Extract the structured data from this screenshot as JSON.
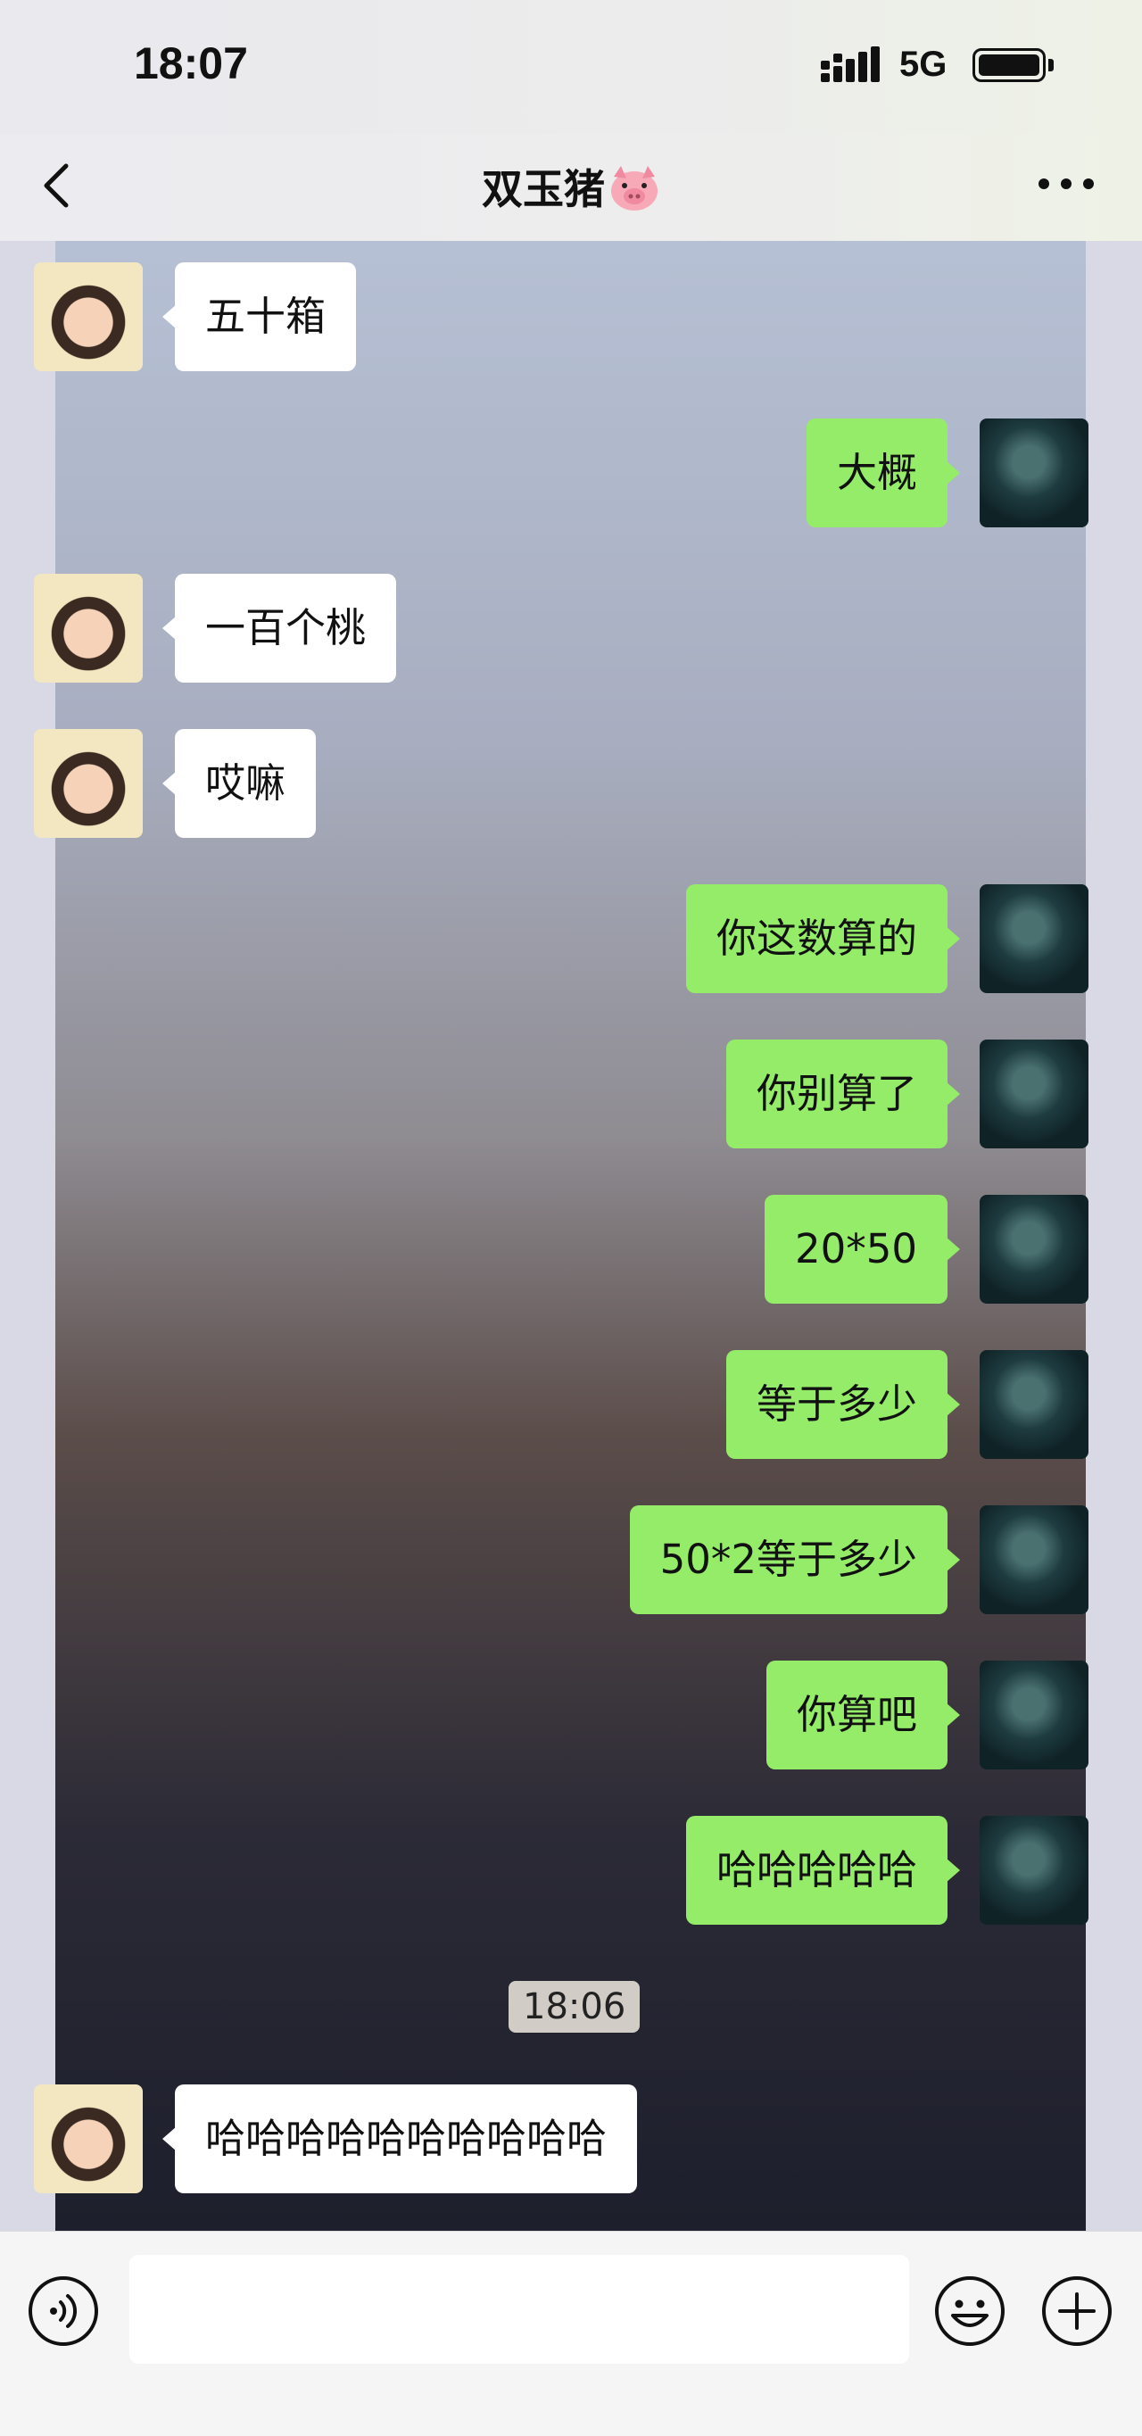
{
  "status_bar": {
    "time": "18:07",
    "network": "5G"
  },
  "header": {
    "title": "双玉猪"
  },
  "messages": [
    {
      "side": "in",
      "text": "五十箱"
    },
    {
      "side": "out",
      "text": "大概"
    },
    {
      "side": "in",
      "text": "一百个桃"
    },
    {
      "side": "in",
      "text": "哎嘛"
    },
    {
      "side": "out",
      "text": "你这数算的"
    },
    {
      "side": "out",
      "text": "你别算了"
    },
    {
      "side": "out",
      "text": "20*50"
    },
    {
      "side": "out",
      "text": "等于多少"
    },
    {
      "side": "out",
      "text": "50*2等于多少"
    },
    {
      "side": "out",
      "text": "你算吧"
    },
    {
      "side": "out",
      "text": "哈哈哈哈哈"
    },
    {
      "side": "in",
      "text": "哈哈哈哈哈哈哈哈哈哈"
    }
  ],
  "timestamp": "18:06",
  "input": {
    "value": ""
  },
  "icons": {
    "back": "back-chevron-icon",
    "pig": "pig-emoji-icon",
    "more": "more-dots-icon",
    "voice": "voice-icon",
    "emoji": "emoji-icon",
    "add": "plus-icon"
  }
}
